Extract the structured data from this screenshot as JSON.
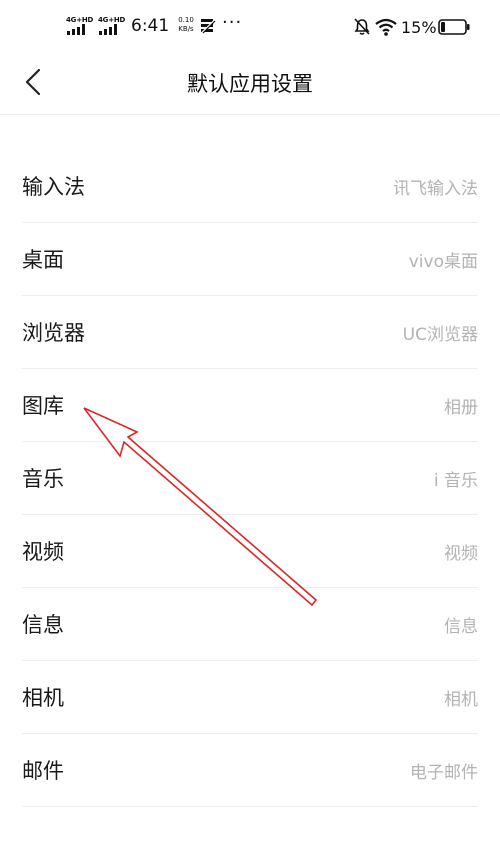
{
  "status_bar": {
    "network_1": "4G+HD",
    "network_2": "4G+HD",
    "time": "6:41",
    "speed_value": "0.10",
    "speed_unit": "KB/s",
    "more": "···",
    "battery": "15%"
  },
  "header": {
    "title": "默认应用设置"
  },
  "list": [
    {
      "label": "输入法",
      "value": "讯飞输入法"
    },
    {
      "label": "桌面",
      "value": "vivo桌面"
    },
    {
      "label": "浏览器",
      "value": "UC浏览器"
    },
    {
      "label": "图库",
      "value": "相册"
    },
    {
      "label": "音乐",
      "value": "i 音乐"
    },
    {
      "label": "视频",
      "value": "视频"
    },
    {
      "label": "信息",
      "value": "信息"
    },
    {
      "label": "相机",
      "value": "相机"
    },
    {
      "label": "邮件",
      "value": "电子邮件"
    }
  ],
  "annotation": {
    "color": "#d42a2a"
  }
}
